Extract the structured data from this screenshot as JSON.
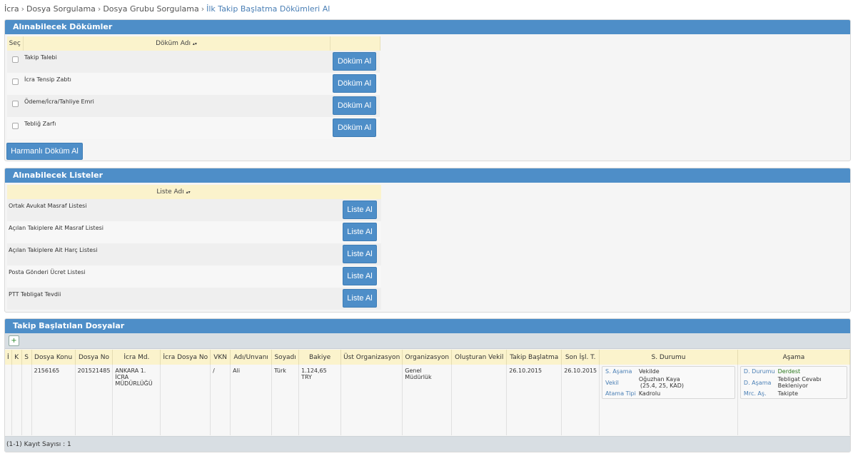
{
  "breadcrumb": [
    "İcra",
    "Dosya Sorgulama",
    "Dosya Grubu Sorgulama",
    "İlk Takip Başlatma Dökümleri Al"
  ],
  "documents": {
    "title": "Alınabilecek Dökümler",
    "col_select": "Seç",
    "col_name": "Döküm Adı",
    "sort_icon": "▴▾",
    "rows": [
      {
        "name": "Takip Talebi",
        "button": "Döküm Al"
      },
      {
        "name": "İcra Tensip Zabtı",
        "button": "Döküm Al"
      },
      {
        "name": "Ödeme/İcra/Tahliye Emri",
        "button": "Döküm Al"
      },
      {
        "name": "Tebliğ Zarfı",
        "button": "Döküm Al"
      }
    ],
    "merge_button": "Harmanlı Döküm Al"
  },
  "lists": {
    "title": "Alınabilecek Listeler",
    "col_name": "Liste Adı",
    "sort_icon": "▴▾",
    "rows": [
      {
        "name": "Ortak Avukat Masraf Listesi",
        "button": "Liste Al"
      },
      {
        "name": "Açılan Takiplere Ait Masraf Listesi",
        "button": "Liste Al"
      },
      {
        "name": "Açılan Takiplere Ait Harç Listesi",
        "button": "Liste Al"
      },
      {
        "name": "Posta Gönderi Ücret Listesi",
        "button": "Liste Al"
      },
      {
        "name": "PTT Tebligat Tevdii",
        "button": "Liste Al"
      }
    ]
  },
  "files": {
    "title": "Takip Başlatılan Dosyalar",
    "toolbar_icon": "export-excel-icon",
    "headers": [
      "İ",
      "K",
      "S",
      "Dosya Konu",
      "Dosya No",
      "İcra Md.",
      "İcra Dosya No",
      "VKN",
      "Adı/Unvanı",
      "Soyadı",
      "Bakiye",
      "Üst Organizasyon",
      "Organizasyon",
      "Oluşturan Vekil",
      "Takip Başlatma",
      "Son İşl. T.",
      "S. Durumu",
      "Aşama"
    ],
    "row": {
      "dosya_konu": "2156165",
      "dosya_no": "201521485",
      "icra_md": "ANKARA 1. İCRA MÜDÜRLÜĞÜ",
      "icra_dosya_no": "",
      "vkn": "/",
      "adi": "Ali",
      "soyadi": "Türk",
      "bakiye": "1.124,65 TRY",
      "ust_org": "",
      "org": "Genel Müdürlük",
      "olusturan": "",
      "takip_baslatma": "26.10.2015",
      "son_isl": "26.10.2015",
      "s_durumu": {
        "s_asama_label": "S. Aşama",
        "s_asama": "Vekilde",
        "vekil_label": "Vekil",
        "vekil": "Oğuzhan Kaya",
        "vekil_detail": "(25.4, 25, KAD)",
        "atama_label": "Atama Tipi",
        "atama": "Kadrolu"
      },
      "asama": {
        "d_durumu_label": "D. Durumu",
        "d_durumu": "Derdest",
        "d_asama_label": "D. Aşama",
        "d_asama": "Tebligat Cevabı Bekleniyor",
        "mrc_label": "Mrc. Aş.",
        "mrc": "Takipte"
      }
    },
    "footer": "(1-1) Kayıt Sayısı : 1"
  },
  "colors": {
    "header": "#4e8ec8",
    "column_header": "#fbf3cc",
    "link": "#4a7fb5",
    "status_green": "#2d7a1e"
  }
}
